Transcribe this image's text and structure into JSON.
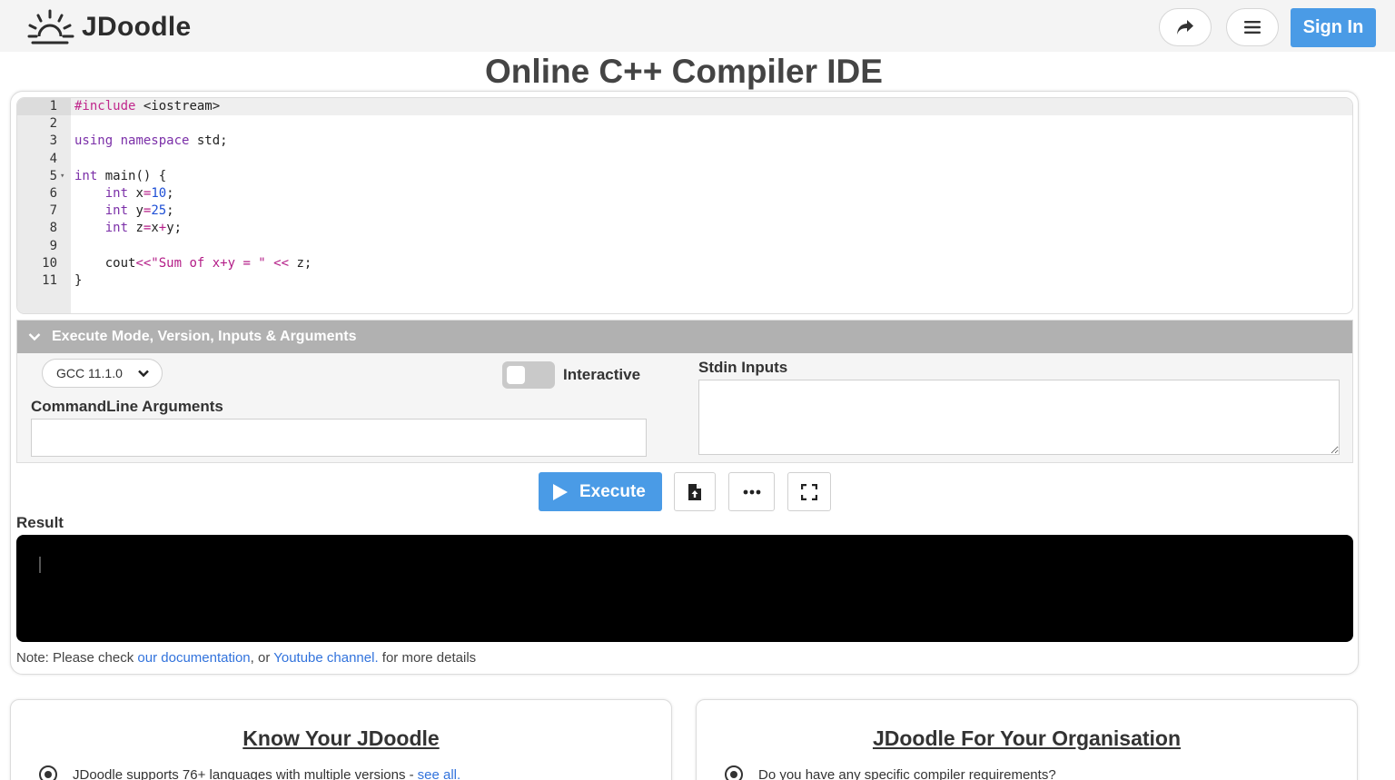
{
  "app": {
    "brand": "JDoodle",
    "sign_in_label": "Sign In"
  },
  "page_title": "Online C++ Compiler IDE",
  "editor": {
    "lines": [
      "1",
      "2",
      "3",
      "4",
      "5",
      "6",
      "7",
      "8",
      "9",
      "10",
      "11"
    ]
  },
  "options": {
    "header": "Execute Mode, Version, Inputs & Arguments",
    "version_selected": "GCC 11.1.0",
    "interactive_label": "Interactive",
    "interactive_on": false,
    "stdin_label": "Stdin Inputs",
    "stdin_value": "",
    "cmd_label": "CommandLine Arguments",
    "cmd_value": ""
  },
  "actions": {
    "execute_label": "Execute",
    "accent": "#4a9be6"
  },
  "result": {
    "label": "Result",
    "output": ""
  },
  "note": {
    "prefix": "Note: Please check ",
    "doc_link": "our documentation",
    "middle": ", or ",
    "youtube_link": "Youtube channel.",
    "suffix": " for more details"
  },
  "cards": {
    "left": {
      "title": "Know Your JDoodle",
      "item_text": "JDoodle supports 76+ languages with multiple versions -",
      "item_link": "see all."
    },
    "right": {
      "title": "JDoodle For Your Organisation",
      "item_text": "Do you have any specific compiler requirements?"
    }
  },
  "icons": {
    "logo": "sun-logo-icon",
    "share": "share-arrow-icon",
    "menu": "hamburger-icon",
    "chevron": "chevron-down-icon",
    "play": "play-icon",
    "upload": "file-upload-icon",
    "more": "ellipsis-icon",
    "fullscreen": "fullscreen-icon"
  }
}
